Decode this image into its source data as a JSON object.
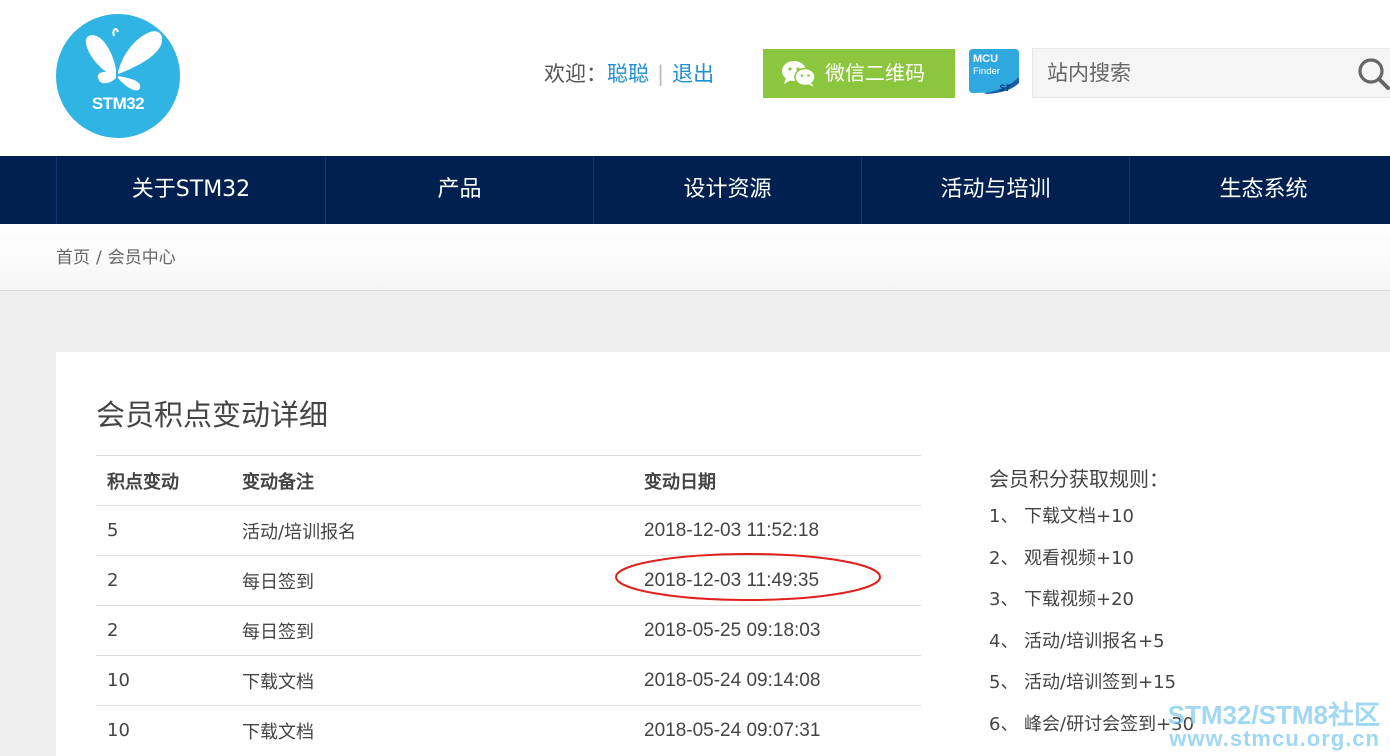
{
  "header": {
    "logo_text": "STM32",
    "welcome_label": "欢迎：",
    "username": "聪聪",
    "separator": "|",
    "logout": "退出",
    "wechat_button": "微信二维码",
    "mcu_finder_line1": "MCU",
    "mcu_finder_line2": "Finder",
    "search_placeholder": "站内搜索"
  },
  "nav": {
    "items": [
      {
        "label": "关于STM32"
      },
      {
        "label": "产品"
      },
      {
        "label": "设计资源"
      },
      {
        "label": "活动与培训"
      },
      {
        "label": "生态系统"
      }
    ]
  },
  "breadcrumb": {
    "home": "首页",
    "separator": "/",
    "current": "会员中心"
  },
  "main": {
    "title": "会员积点变动详细",
    "table": {
      "headers": [
        "积点变动",
        "变动备注",
        "变动日期"
      ],
      "rows": [
        {
          "points": "5",
          "note": "活动/培训报名",
          "date": "2018-12-03 11:52:18"
        },
        {
          "points": "2",
          "note": "每日签到",
          "date": "2018-12-03 11:49:35"
        },
        {
          "points": "2",
          "note": "每日签到",
          "date": "2018-05-25 09:18:03"
        },
        {
          "points": "10",
          "note": "下载文档",
          "date": "2018-05-24 09:14:08"
        },
        {
          "points": "10",
          "note": "下载文档",
          "date": "2018-05-24 09:07:31"
        }
      ]
    }
  },
  "rules": {
    "title": "会员积分获取规则：",
    "items": [
      {
        "num": "1、",
        "text": "下载文档+10"
      },
      {
        "num": "2、",
        "text": "观看视频+10"
      },
      {
        "num": "3、",
        "text": "下载视频+20"
      },
      {
        "num": "4、",
        "text": "活动/培训报名+5"
      },
      {
        "num": "5、",
        "text": "活动/培训签到+15"
      },
      {
        "num": "6、",
        "text": "峰会/研讨会签到+30"
      }
    ]
  },
  "watermark": {
    "line1": "STM32/STM8社区",
    "line2": "www.stmcu.org.cn"
  },
  "colors": {
    "nav_bg": "#00214f",
    "accent_link": "#1e8fd1",
    "wechat_green": "#8cc63f",
    "logo_blue": "#2fb4e4",
    "highlight_red": "#e0201c"
  }
}
